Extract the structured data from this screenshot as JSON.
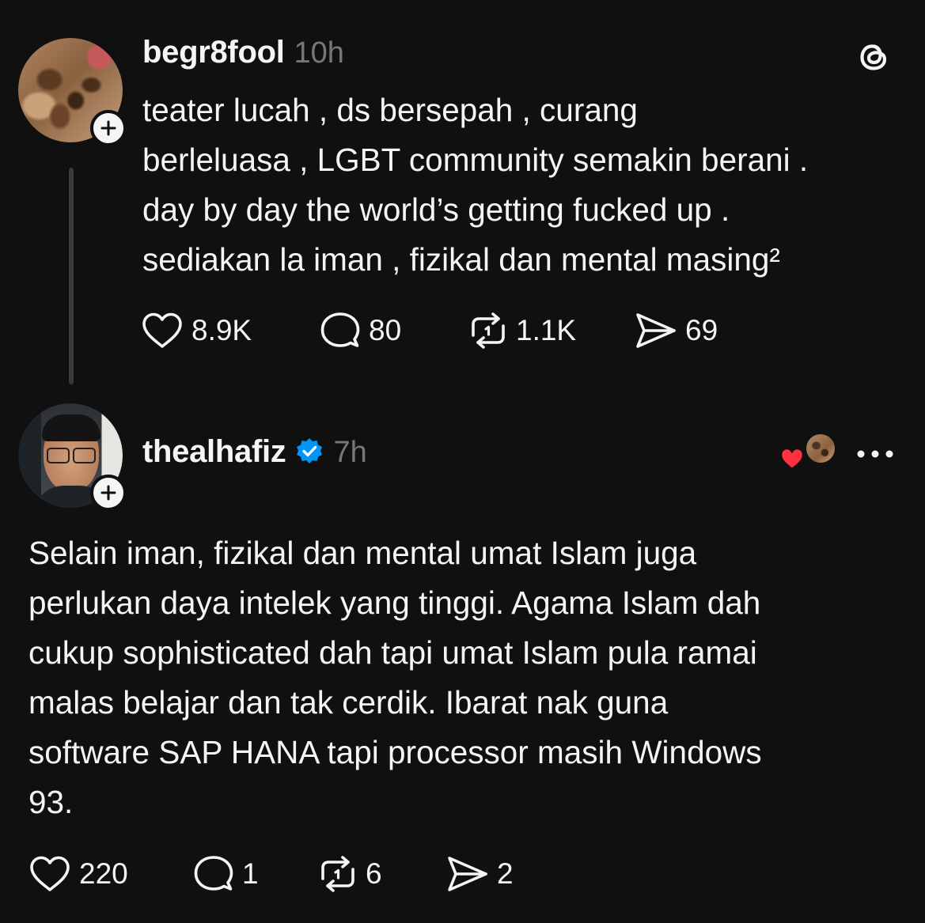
{
  "posts": [
    {
      "username": "begr8fool",
      "time": "10h",
      "text_lines": [
        "teater lucah , ds bersepah , curang",
        "berleluasa , LGBT community semakin berani .",
        "day by day the world’s getting fucked up .",
        "sediakan la iman , fizikal dan mental masing²"
      ],
      "stats": {
        "likes": "8.9K",
        "replies": "80",
        "reposts": "1.1K",
        "shares": "69"
      }
    },
    {
      "username": "thealhafiz",
      "verified": true,
      "time": "7h",
      "text_lines": [
        "Selain iman, fizikal dan mental umat Islam juga",
        "perlukan daya intelek yang tinggi. Agama Islam dah",
        "cukup sophisticated dah tapi umat Islam pula ramai",
        "malas belajar dan tak cerdik. Ibarat nak guna",
        "software SAP HANA tapi processor masih Windows",
        "93."
      ],
      "stats": {
        "likes": "220",
        "replies": "1",
        "reposts": "6",
        "shares": "2"
      }
    }
  ],
  "icons": {
    "brand": "threads-logo-icon",
    "like": "heart-icon",
    "reply": "speech-bubble-icon",
    "repost": "repost-icon",
    "share": "send-icon",
    "follow": "plus-icon",
    "verified": "verified-badge-icon",
    "more": "more-options-icon"
  },
  "colors": {
    "background": "#101010",
    "text": "#f3f5f7",
    "secondary_text": "#777777",
    "verified_blue": "#0095f6",
    "heart_red": "#ff3040"
  }
}
